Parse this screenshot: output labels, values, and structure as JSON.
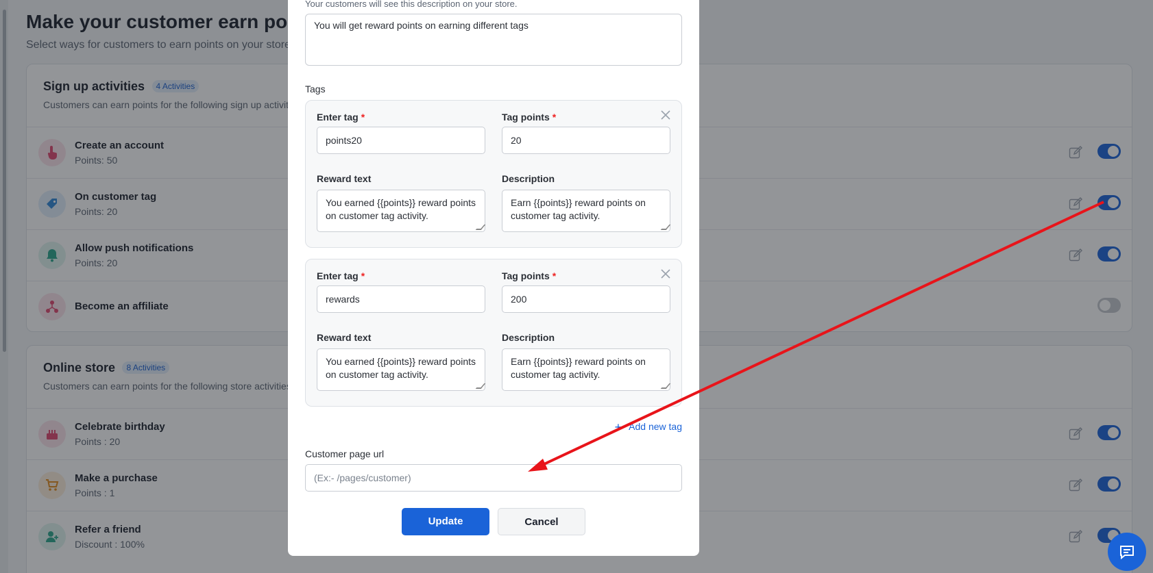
{
  "page": {
    "title": "Make your customer earn points",
    "subtitle": "Select ways for customers to earn points on your store"
  },
  "signup": {
    "title": "Sign up activities",
    "badge": "4 Activities",
    "desc": "Customers can earn points for the following sign up activities",
    "items": [
      {
        "name": "Create an account",
        "sub": "Points: 50",
        "enabled": true
      },
      {
        "name": "On customer tag",
        "sub": "Points: 20",
        "enabled": true
      },
      {
        "name": "Allow push notifications",
        "sub": "Points: 20",
        "enabled": true
      },
      {
        "name": "Become an affiliate",
        "sub": "",
        "enabled": false
      }
    ]
  },
  "store": {
    "title": "Online store",
    "badge": "8 Activities",
    "desc": "Customers can earn points for the following store activities",
    "items": [
      {
        "name": "Celebrate birthday",
        "sub": "Points : 20",
        "enabled": true
      },
      {
        "name": "Make a purchase",
        "sub": "Points : 1",
        "enabled": true
      },
      {
        "name": "Refer a friend",
        "sub": "Discount : 100%",
        "enabled": true
      }
    ]
  },
  "modal": {
    "hint": "Your customers will see this description on your store.",
    "description_value": "You will get reward points on earning different tags",
    "tags_label": "Tags",
    "tag_label": "Enter tag",
    "points_label": "Tag points",
    "reward_label": "Reward text",
    "desc_label": "Description",
    "required_mark": "*",
    "tags": [
      {
        "tag": "points20",
        "points": "20",
        "reward": "You earned {{points}} reward points on customer tag activity.",
        "description": "Earn {{points}} reward points on customer tag activity."
      },
      {
        "tag": "rewards",
        "points": "200",
        "reward": "You earned {{points}} reward points on customer tag activity.",
        "description": "Earn {{points}} reward points on customer tag activity."
      }
    ],
    "add_tag": "Add new tag",
    "url_label": "Customer page url",
    "url_placeholder": "(Ex:- /pages/customer)",
    "update": "Update",
    "cancel": "Cancel"
  },
  "colors": {
    "accent": "#1a63d8",
    "arrow": "#e8141a"
  }
}
